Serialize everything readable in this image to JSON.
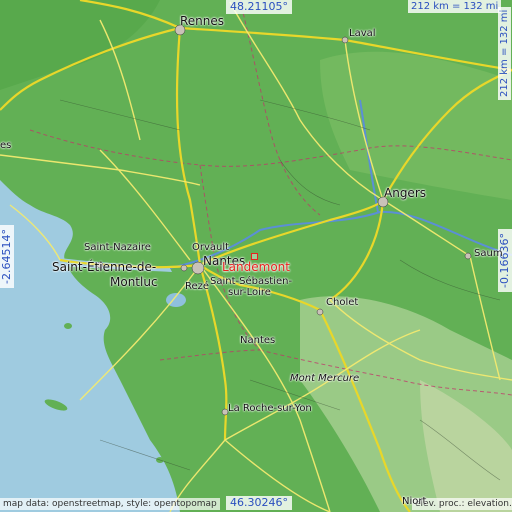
{
  "map": {
    "target_place": "Landemont",
    "marker_color": "#e8231f",
    "colors": {
      "sea": "#9fcbe0",
      "lowland": "#4fa647",
      "upland": "#8cc07a",
      "motorway": "#e8d72a",
      "primary_road": "#f2e24a",
      "river": "#5b8fd6",
      "border": "#c0356a"
    }
  },
  "coordinates": {
    "north": "48.21105°",
    "south": "46.30246°",
    "west": "-2.64514°",
    "east": "-0.16636°"
  },
  "scale": {
    "horizontal": "212 km = 132 mi",
    "vertical": "212 km = 132 mi"
  },
  "attribution": {
    "left": "map data: openstreetmap, style: opentopomap",
    "right": "elev. proc.: elevation.city"
  },
  "places": {
    "rennes": "Rennes",
    "laval": "Laval",
    "angers": "Angers",
    "saumur": "Saum",
    "saint_nazaire": "Saint-Nazaire",
    "saint_etienne": "Saint-Étienne-de-",
    "montluc": "Montluc",
    "orvault": "Orvault",
    "nantes": "Nantes",
    "reze": "Rezé",
    "landemont": "Landemont",
    "saint_sebastien_1": "Saint-Sébastien-",
    "saint_sebastien_2": "sur-Loire",
    "cholet": "Cholet",
    "mont_mercure": "Mont Mercure",
    "la_roche": "La Roche-sur-Yon",
    "niort": "Niort",
    "nantes_short": "Nantes",
    "es": "es"
  }
}
